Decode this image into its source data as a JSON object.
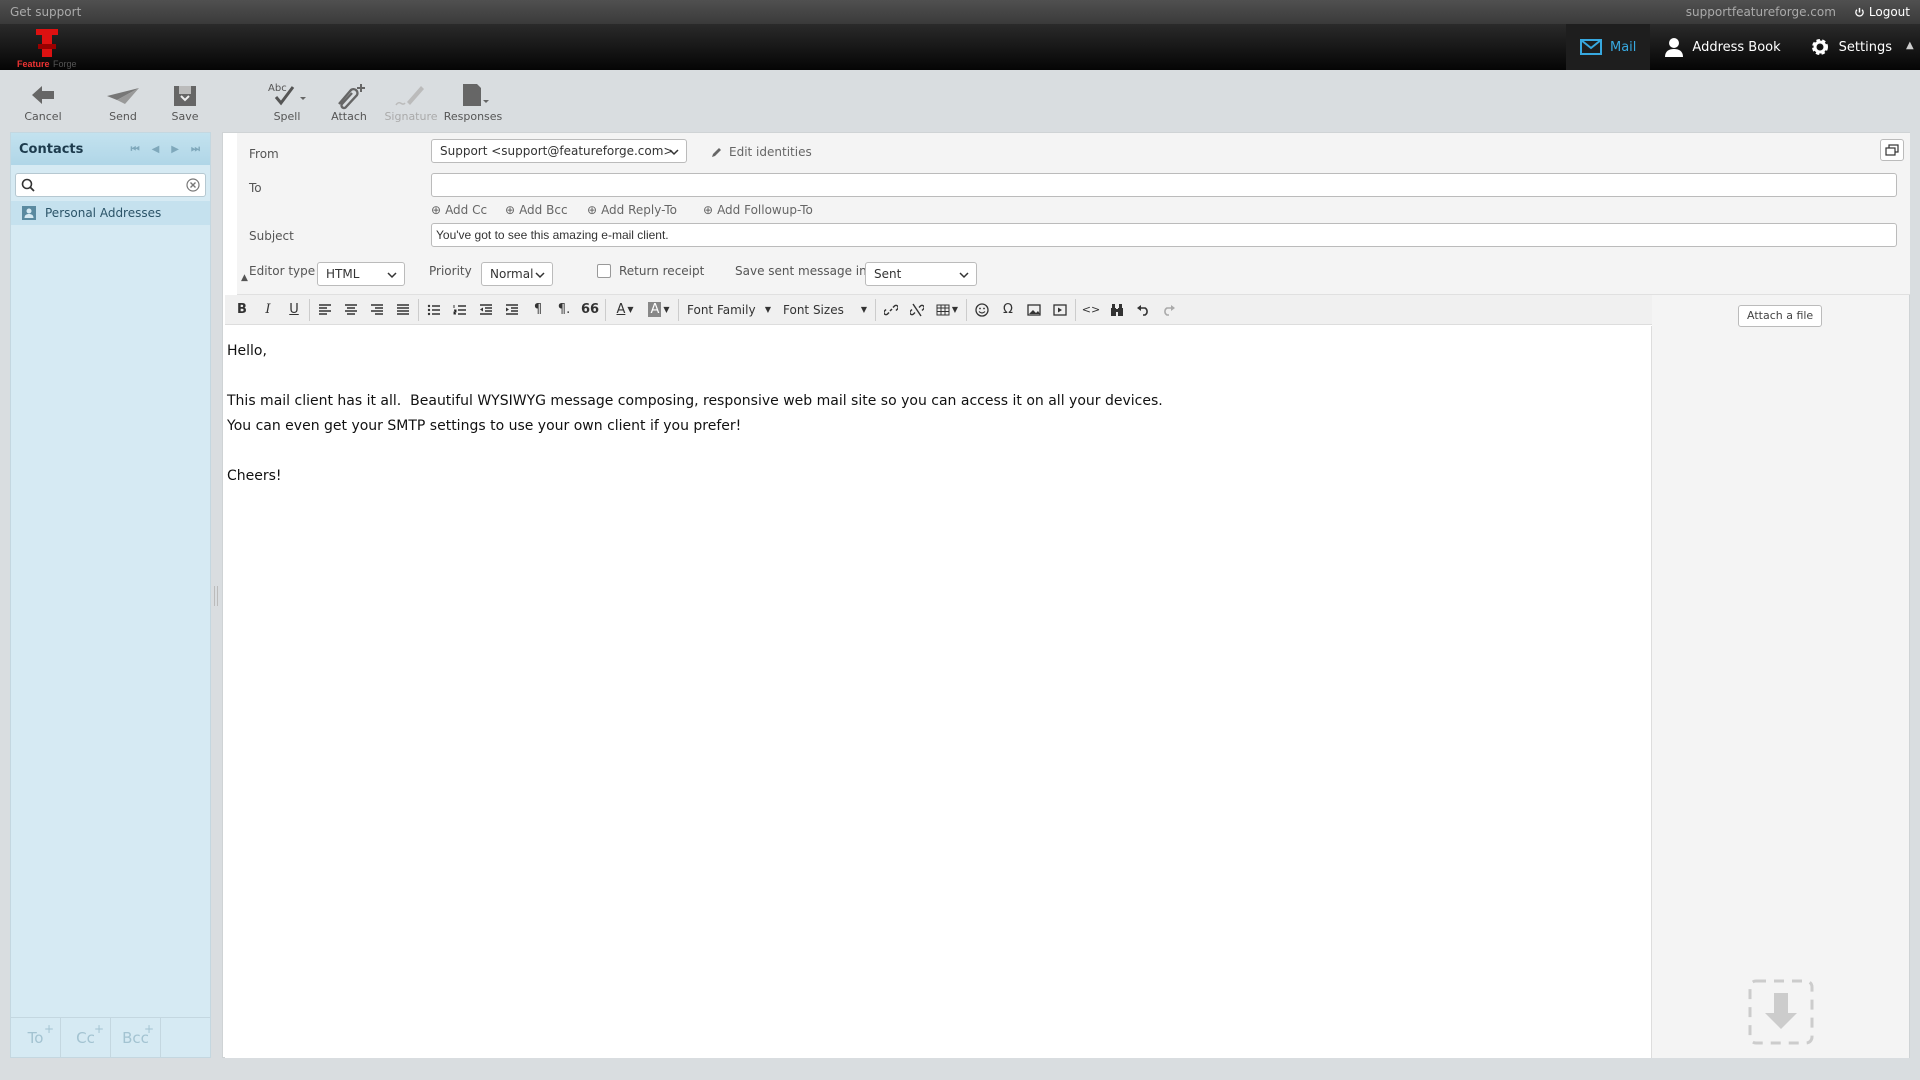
{
  "topline": {
    "support_link": "Get support",
    "username": "supportfeatureforge.com",
    "logout_label": "Logout"
  },
  "logo": {
    "text": "FeatureForge"
  },
  "taskbar": {
    "items": [
      {
        "label": "Mail",
        "active": true
      },
      {
        "label": "Address Book",
        "active": false
      },
      {
        "label": "Settings",
        "active": false
      }
    ]
  },
  "toolbar": {
    "cancel": "Cancel",
    "send": "Send",
    "save": "Save",
    "spell": "Spell",
    "spell_icon_text": "Abc",
    "attach": "Attach",
    "signature": "Signature",
    "responses": "Responses"
  },
  "contacts": {
    "title": "Contacts",
    "search_placeholder": "",
    "items": [
      "Personal Addresses"
    ],
    "footer": [
      "To",
      "Cc",
      "Bcc"
    ],
    "footer_plus": "+"
  },
  "compose": {
    "from_label": "From",
    "from_value": "Support <support@featureforge.com>",
    "edit_identities": "Edit identities",
    "to_label": "To",
    "to_value": "",
    "add_cc": "Add Cc",
    "add_bcc": "Add Bcc",
    "add_reply_to": "Add Reply-To",
    "add_followup_to": "Add Followup-To",
    "subject_label": "Subject",
    "subject_value": "You've got to see this amazing e-mail client.",
    "editor_type_label": "Editor type",
    "editor_type_value": "HTML",
    "priority_label": "Priority",
    "priority_value": "Normal",
    "return_receipt_label": "Return receipt",
    "save_sent_label": "Save sent message in",
    "save_sent_value": "Sent"
  },
  "editor_toolbar": {
    "bold": "B",
    "italic": "I",
    "underline": "U",
    "font_family": "Font Family",
    "font_sizes": "Font Sizes",
    "text_color": "A",
    "bg_color": "A",
    "omega": "Ω",
    "code": "<>",
    "pilcrow_ltr": "¶",
    "pilcrow_rtl": "¶.",
    "blockquote": "66"
  },
  "body": {
    "lines": [
      "Hello,",
      "",
      "This mail client has it all.  Beautiful WYSIWYG message composing, responsive web mail site so you can access it on all your devices.",
      "You can even get your SMTP settings to use your own client if you prefer!",
      "",
      "Cheers!"
    ]
  },
  "attachments": {
    "attach_button": "Attach a file"
  },
  "colors": {
    "accent": "#37a8df",
    "contacts_bg": "#d6eaf3",
    "header_bg": "#050505"
  }
}
